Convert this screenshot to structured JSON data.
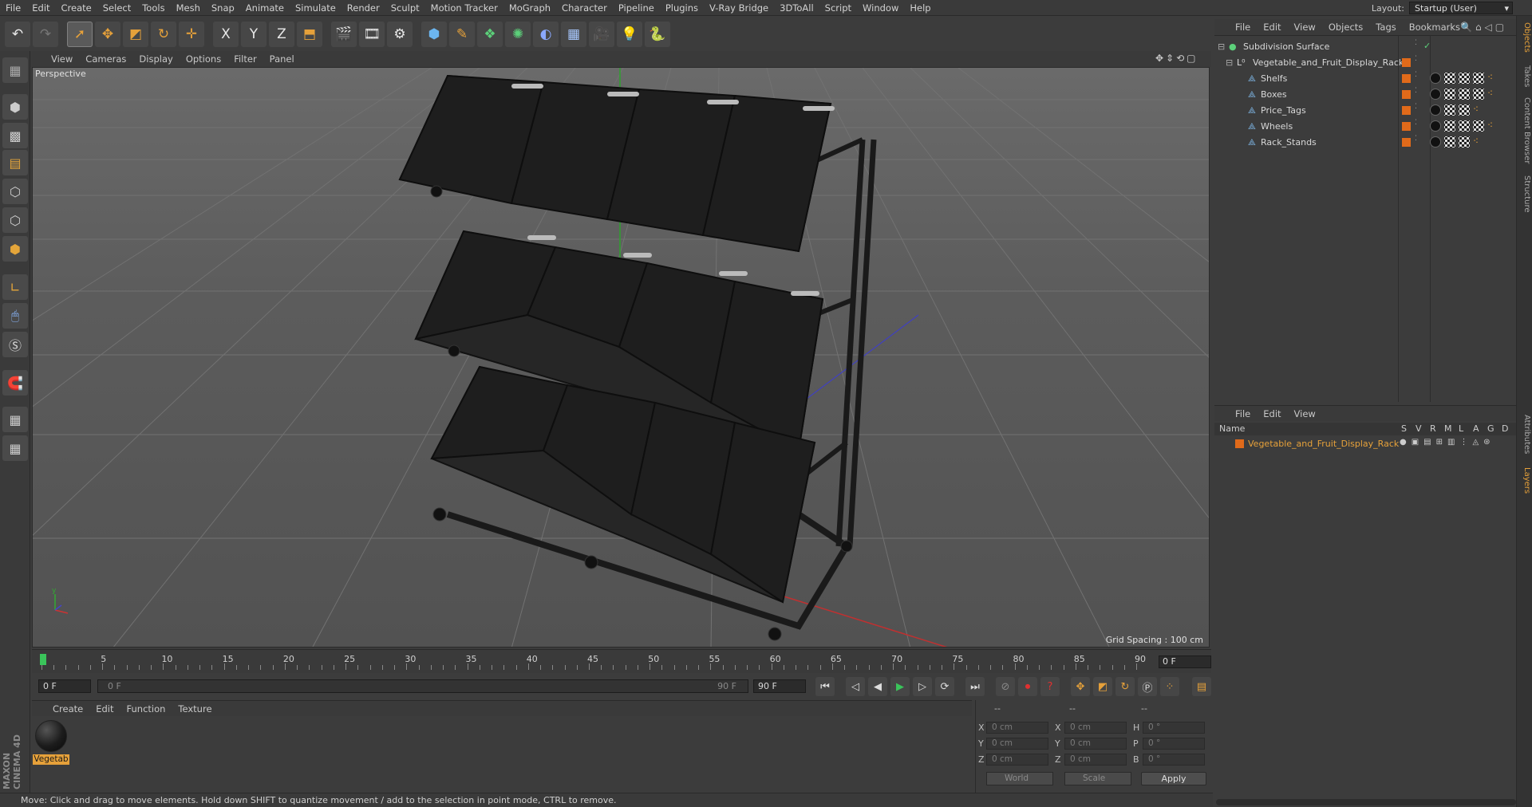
{
  "menubar": {
    "items": [
      "File",
      "Edit",
      "Create",
      "Select",
      "Tools",
      "Mesh",
      "Snap",
      "Animate",
      "Simulate",
      "Render",
      "Sculpt",
      "Motion Tracker",
      "MoGraph",
      "Character",
      "Pipeline",
      "Plugins",
      "V-Ray Bridge",
      "3DToAll",
      "Script",
      "Window",
      "Help"
    ],
    "layout_label": "Layout:",
    "layout_value": "Startup (User)"
  },
  "toolbar": {
    "icons": [
      "undo-icon",
      "redo-icon",
      "live-select-icon",
      "move-icon",
      "scale-icon",
      "rotate-icon",
      "transform-icon",
      "x-axis-icon",
      "y-axis-icon",
      "z-axis-icon",
      "coordinate-system-icon",
      "render-view-icon",
      "render-picture-viewer-icon",
      "edit-render-settings-icon",
      "cube-icon",
      "pen-icon",
      "subdivision-icon",
      "cloner-icon",
      "deformer-icon",
      "floor-icon",
      "camera-icon",
      "light-icon",
      "python-icon"
    ],
    "axis_labels": [
      "X",
      "Y",
      "Z"
    ]
  },
  "viewport": {
    "menu": [
      "View",
      "Cameras",
      "Display",
      "Options",
      "Filter",
      "Panel"
    ],
    "label": "Perspective",
    "grid_spacing": "Grid Spacing : 100 cm"
  },
  "timeline": {
    "ticks": [
      "0",
      "5",
      "10",
      "15",
      "20",
      "25",
      "30",
      "35",
      "40",
      "45",
      "50",
      "55",
      "60",
      "65",
      "70",
      "75",
      "80",
      "85",
      "90"
    ],
    "current_frame_right": "0 F",
    "start_field": "0 F",
    "range_start": "0 F",
    "range_end": "90 F",
    "end_field": "90 F"
  },
  "materials": {
    "menu": [
      "Create",
      "Edit",
      "Function",
      "Texture"
    ],
    "items": [
      {
        "name": "Vegetab"
      }
    ]
  },
  "coordinates": {
    "headers": [
      "--",
      "--",
      "--"
    ],
    "rows": [
      {
        "a": "X",
        "av": "0 cm",
        "b": "X",
        "bv": "0 cm",
        "c": "H",
        "cv": "0 °"
      },
      {
        "a": "Y",
        "av": "0 cm",
        "b": "Y",
        "bv": "0 cm",
        "c": "P",
        "cv": "0 °"
      },
      {
        "a": "Z",
        "av": "0 cm",
        "b": "Z",
        "bv": "0 cm",
        "c": "B",
        "cv": "0 °"
      }
    ],
    "world": "World",
    "scale": "Scale",
    "apply": "Apply"
  },
  "status": "Move: Click and drag to move elements. Hold down SHIFT to quantize movement / add to the selection in point mode, CTRL to remove.",
  "objects": {
    "menu": [
      "File",
      "Edit",
      "View",
      "Objects",
      "Tags",
      "Bookmarks"
    ],
    "tree": [
      {
        "name": "Subdivision Surface",
        "level": 0
      },
      {
        "name": "Vegetable_and_Fruit_Display_Rack",
        "level": 1
      },
      {
        "name": "Shelfs",
        "level": 2
      },
      {
        "name": "Boxes",
        "level": 2
      },
      {
        "name": "Price_Tags",
        "level": 2
      },
      {
        "name": "Wheels",
        "level": 2
      },
      {
        "name": "Rack_Stands",
        "level": 2
      }
    ]
  },
  "layers": {
    "menu": [
      "File",
      "Edit",
      "View"
    ],
    "columns": [
      "Name",
      "S",
      "V",
      "R",
      "M",
      "L",
      "A",
      "G",
      "D"
    ],
    "rows": [
      {
        "name": "Vegetable_and_Fruit_Display_Rack",
        "color": "#e06a1a"
      }
    ]
  },
  "right_tabs": [
    "Objects",
    "Takes",
    "Content Browser",
    "Structure",
    "Attributes",
    "Layers"
  ],
  "brand": "MAXON CINEMA 4D",
  "colors": {
    "accent": "#e6a13a",
    "selected_text": "#e6a13a",
    "layer_color": "#e06a1a"
  }
}
